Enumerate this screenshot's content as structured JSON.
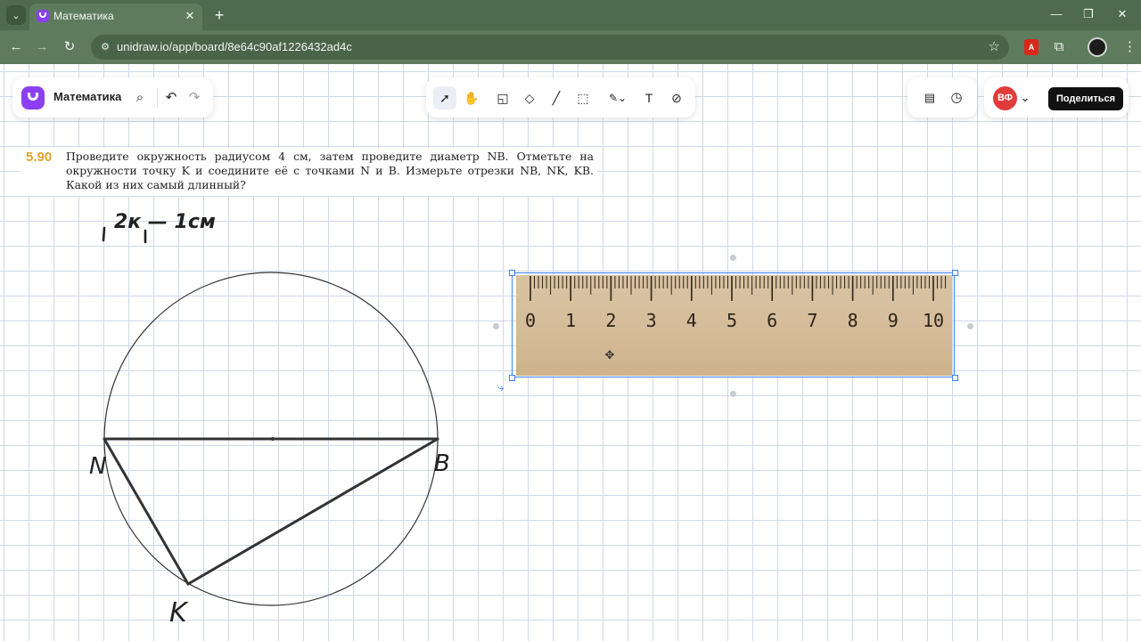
{
  "browser": {
    "tab_title": "Математика",
    "url": "unidraw.io/app/board/8e64c90af1226432ad4c",
    "icons": {
      "tab_list": "chevron-down-icon",
      "close": "close-icon",
      "new_tab": "plus-icon",
      "back": "arrow-left-icon",
      "forward": "arrow-right-icon",
      "reload": "reload-icon",
      "site_info": "tune-icon",
      "bookmark": "star-icon",
      "pdf_extension": "pdf-icon",
      "extensions": "puzzle-icon",
      "menu": "more-vertical-icon"
    },
    "glyphs": {
      "tab_list": "⌄",
      "close": "✕",
      "new_tab": "+",
      "back": "←",
      "forward": "→",
      "reload": "↻",
      "site_info": "⚙",
      "bookmark": "☆",
      "pdf": "A",
      "extensions": "⧉",
      "menu": "⋮",
      "minimize": "—",
      "maximize": "❐",
      "window_close": "✕"
    }
  },
  "app": {
    "board_title": "Математика",
    "glyphs": {
      "search": "⌕",
      "undo": "↶",
      "redo": "↷"
    },
    "toolbar": [
      {
        "name": "select-tool",
        "glyph": "➚",
        "active": true
      },
      {
        "name": "hand-tool",
        "glyph": "✋",
        "active": false
      },
      {
        "name": "sticker-tool",
        "glyph": "◱",
        "active": false
      },
      {
        "name": "shapes-tool",
        "glyph": "◇",
        "active": false
      },
      {
        "name": "line-tool",
        "glyph": "╱",
        "active": false
      },
      {
        "name": "frame-tool",
        "glyph": "⬚",
        "active": false
      },
      {
        "name": "pen-tool",
        "glyph": "✎⌄",
        "active": false
      },
      {
        "name": "text-tool",
        "glyph": "T",
        "active": false
      },
      {
        "name": "attach-tool",
        "glyph": "⊘",
        "active": false
      }
    ],
    "right_glyphs": {
      "template": "▤",
      "history": "◷",
      "avatar_menu": "⌄"
    },
    "avatar_initials": "ВФ",
    "share_label": "Поделиться"
  },
  "problem": {
    "number": "5.90",
    "text": "Проведите окружность радиусом 4 см, затем проведите диаметр NB. Отметьте на окружности точку K и соедините её с точками N и B. Измерьте отрезки NB, NK, KB. Какой из них самый длинный?"
  },
  "handwriting": {
    "note": "2к — 1см",
    "point_n": "N",
    "point_b": "B",
    "point_k": "K"
  },
  "ruler": {
    "labels": [
      "0",
      "1",
      "2",
      "3",
      "4",
      "5",
      "6",
      "7",
      "8",
      "9",
      "10"
    ]
  }
}
